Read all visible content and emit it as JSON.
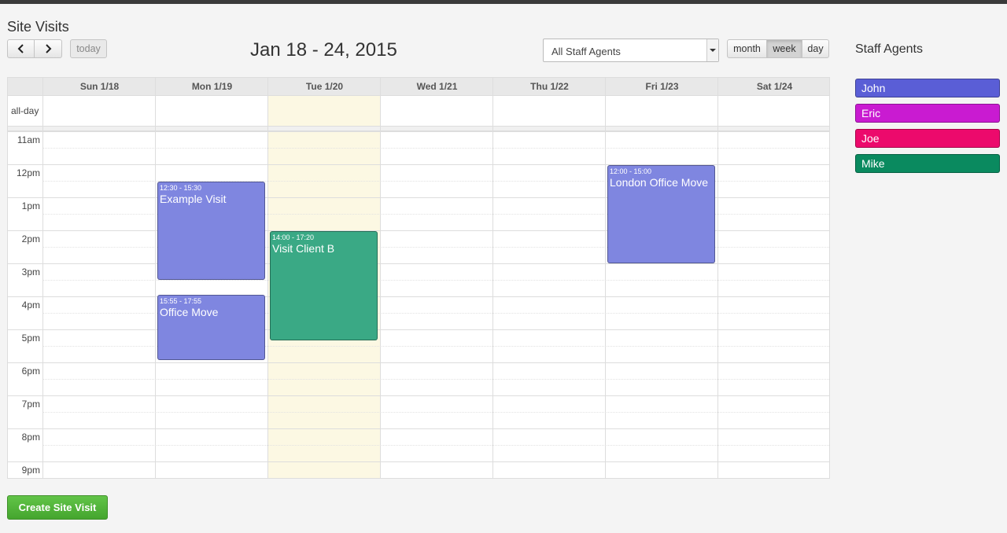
{
  "page": {
    "title": "Site Visits"
  },
  "toolbar": {
    "prev_icon": "chevron-left-icon",
    "next_icon": "chevron-right-icon",
    "today_label": "today",
    "range_title": "Jan 18 - 24, 2015",
    "views": [
      {
        "label": "month",
        "active": false
      },
      {
        "label": "week",
        "active": true
      },
      {
        "label": "day",
        "active": false
      }
    ]
  },
  "staff_filter": {
    "selected": "All Staff Agents"
  },
  "calendar": {
    "allday_label": "all-day",
    "days": [
      "Sun 1/18",
      "Mon 1/19",
      "Tue 1/20",
      "Wed 1/21",
      "Thu 1/22",
      "Fri 1/23",
      "Sat 1/24"
    ],
    "today_index": 2,
    "time_labels": [
      "11am",
      "12pm",
      "1pm",
      "2pm",
      "3pm",
      "4pm",
      "5pm",
      "6pm",
      "7pm",
      "8pm",
      "9pm"
    ],
    "events": [
      {
        "day": 1,
        "start": "12:30",
        "end": "15:30",
        "time": "12:30 - 15:30",
        "title": "Example Visit",
        "color": "#7f86e0"
      },
      {
        "day": 1,
        "start": "15:55",
        "end": "17:55",
        "time": "15:55 - 17:55",
        "title": "Office Move",
        "color": "#7f86e0"
      },
      {
        "day": 2,
        "start": "14:00",
        "end": "17:20",
        "time": "14:00 - 17:20",
        "title": "Visit Client B",
        "color": "#3aa985"
      },
      {
        "day": 5,
        "start": "12:00",
        "end": "15:00",
        "time": "12:00 - 15:00",
        "title": "London Office Move",
        "color": "#7f86e0"
      }
    ]
  },
  "agents_panel": {
    "title": "Staff Agents",
    "agents": [
      {
        "name": "John",
        "color": "#5a5ed6"
      },
      {
        "name": "Eric",
        "color": "#c91bd1"
      },
      {
        "name": "Joe",
        "color": "#ec0a6c"
      },
      {
        "name": "Mike",
        "color": "#0a8a5f"
      }
    ]
  },
  "actions": {
    "create_label": "Create Site Visit"
  }
}
